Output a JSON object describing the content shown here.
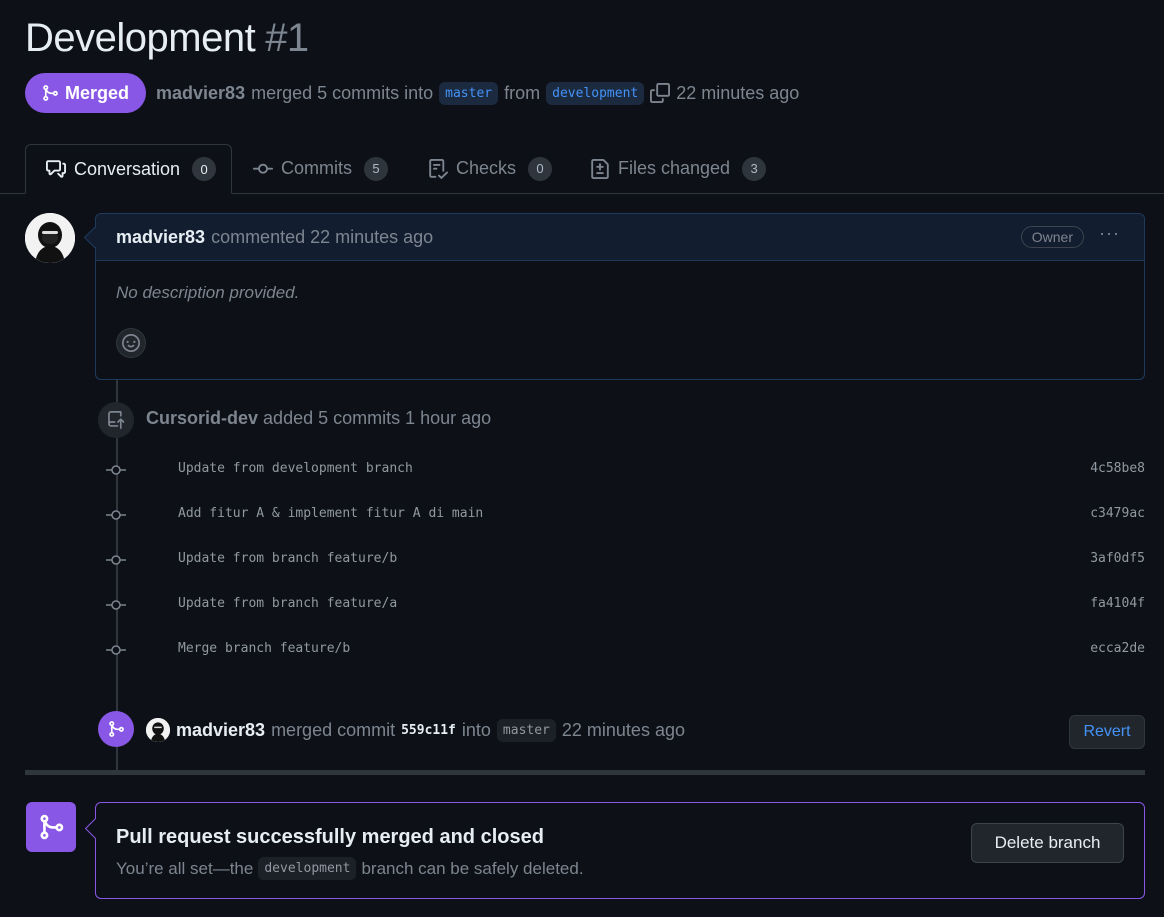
{
  "pr": {
    "title": "Development",
    "number": "#1",
    "status": "Merged",
    "author": "madvier83",
    "summary_mid": "merged 5 commits into",
    "base_branch": "master",
    "from_text": "from",
    "head_branch": "development",
    "time": "22 minutes ago"
  },
  "tabs": [
    {
      "label": "Conversation",
      "count": "0",
      "icon": "comment-discussion-icon"
    },
    {
      "label": "Commits",
      "count": "5",
      "icon": "git-commit-icon"
    },
    {
      "label": "Checks",
      "count": "0",
      "icon": "checklist-icon"
    },
    {
      "label": "Files changed",
      "count": "3",
      "icon": "file-diff-icon"
    }
  ],
  "comment": {
    "author": "madvier83",
    "action": "commented 22 minutes ago",
    "role": "Owner",
    "menu": "···",
    "body": "No description provided."
  },
  "commits_event": {
    "actor": "Cursorid-dev",
    "text": "added 5 commits 1 hour ago",
    "commits": [
      {
        "message": "Update from development branch",
        "sha": "4c58be8"
      },
      {
        "message": "Add fitur A & implement fitur A di main",
        "sha": "c3479ac"
      },
      {
        "message": "Update from branch feature/b",
        "sha": "3af0df5"
      },
      {
        "message": "Update from branch feature/a",
        "sha": "fa4104f"
      },
      {
        "message": "Merge branch feature/b",
        "sha": "ecca2de"
      }
    ]
  },
  "merge_event": {
    "actor": "madvier83",
    "text1": "merged commit",
    "sha": "559c11f",
    "text2": "into",
    "branch": "master",
    "time": "22 minutes ago",
    "revert_label": "Revert"
  },
  "merged_box": {
    "title": "Pull request successfully merged and closed",
    "sub_prefix": "You’re all set—the",
    "branch": "development",
    "sub_suffix": "branch can be safely deleted.",
    "delete_label": "Delete branch"
  },
  "colors": {
    "merged_purple": "#8957e5",
    "link_blue": "#4493f8",
    "background": "#0d1117"
  }
}
